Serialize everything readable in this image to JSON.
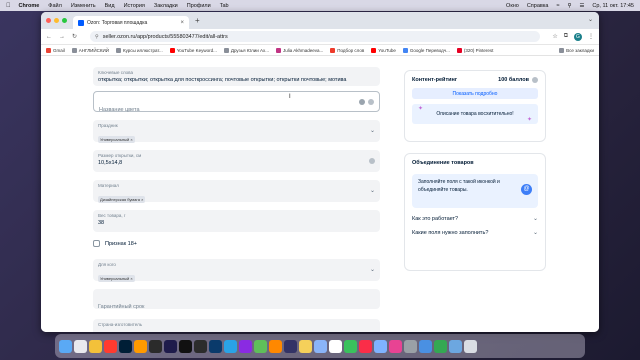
{
  "menubar": {
    "app": "Chrome",
    "items": [
      "Файл",
      "Изменить",
      "Вид",
      "История",
      "Закладки",
      "Профили",
      "Tab"
    ],
    "right": [
      "Окно",
      "Справка"
    ],
    "clock": "Ср, 11 окт.  17:45"
  },
  "browser": {
    "tab_title": "Ozon: Торговая площадка",
    "url": "seller.ozon.ru/app/products/555803477/edit/all-attrs",
    "avatar_letter": "G",
    "bookmarks": [
      {
        "label": "Gmail",
        "color": "#ea4335"
      },
      {
        "label": "АНГЛИЙСКИЙ",
        "color": "#8a8f99"
      },
      {
        "label": "Курсы иллюстрат...",
        "color": "#8a8f99"
      },
      {
        "label": "YouTube Keyword...",
        "color": "#ff0000"
      },
      {
        "label": "Друзья Юлии Ах...",
        "color": "#8a8f99"
      },
      {
        "label": "Julia Akhmadeeva...",
        "color": "#c13584"
      },
      {
        "label": "Подбор слов",
        "color": "#ee3b2b"
      },
      {
        "label": "YouTube",
        "color": "#ff0000"
      },
      {
        "label": "Google Переводч...",
        "color": "#4285f4"
      },
      {
        "label": "(320) Pinterest",
        "color": "#e60023"
      }
    ],
    "all_bookmarks": "Все закладки"
  },
  "form": {
    "keywords_label": "Ключевые слова",
    "keywords_value": "открытка; открытки; открытка для посткроссинга; почтовые открытки; открытки почтовые; мотива",
    "color_name_placeholder": "Название цвета",
    "occasion_label": "Праздник",
    "occasion_tag": "Универсальный",
    "size_label": "Размер открытки, см",
    "size_value": "10,5х14,8",
    "material_label": "Материал",
    "material_tag": "Дизайнерская бумага",
    "weight_label": "Вес товара, г",
    "weight_value": "38",
    "adult_label": "Признак 18+",
    "for_whom_label": "Для кого",
    "for_whom_tag": "Универсальный",
    "warranty_placeholder": "Гарантийный срок",
    "country_label": "Страна-изготовитель"
  },
  "rating": {
    "title": "Контент-рейтинг",
    "score": "100 баллов",
    "button": "Показать подробно",
    "message": "Описание товара восхитительно!"
  },
  "merge": {
    "title": "Объединение товаров",
    "info": "Заполняйте поля с такой иконкой и объединяйте товары.",
    "faq": [
      "Как это работает?",
      "Какие поля нужно заполнить?"
    ]
  },
  "dock": {
    "apps": [
      "finder",
      "launchpad",
      "chrome",
      "yandex-browser",
      "photoshop",
      "illustrator",
      "ai-app",
      "premiere",
      "capcut",
      "davinci",
      "lightroom",
      "telegram",
      "video-app",
      "maps",
      "vlc",
      "app-x",
      "notes",
      "finder-alt",
      "calendar",
      "facetime",
      "music",
      "preview",
      "app-pink",
      "settings",
      "app-blue",
      "app-green",
      "folder",
      "trash"
    ],
    "colors": [
      "#5aa9f5",
      "#e9e9ee",
      "#f3c13a",
      "#ff3b30",
      "#001e36",
      "#ff9a00",
      "#2b2b2b",
      "#1e1b4b",
      "#111111",
      "#2c2c2c",
      "#0a3a6b",
      "#2aa3e6",
      "#8a2be2",
      "#5fbf5a",
      "#ff8800",
      "#333366",
      "#f5d05a",
      "#8ab4f8",
      "#ffffff",
      "#3ac15d",
      "#fa2d48",
      "#7fb3ff",
      "#e84393",
      "#9aa0a6",
      "#4a90e2",
      "#34a853",
      "#6ca7e0",
      "#d9dde3"
    ]
  }
}
